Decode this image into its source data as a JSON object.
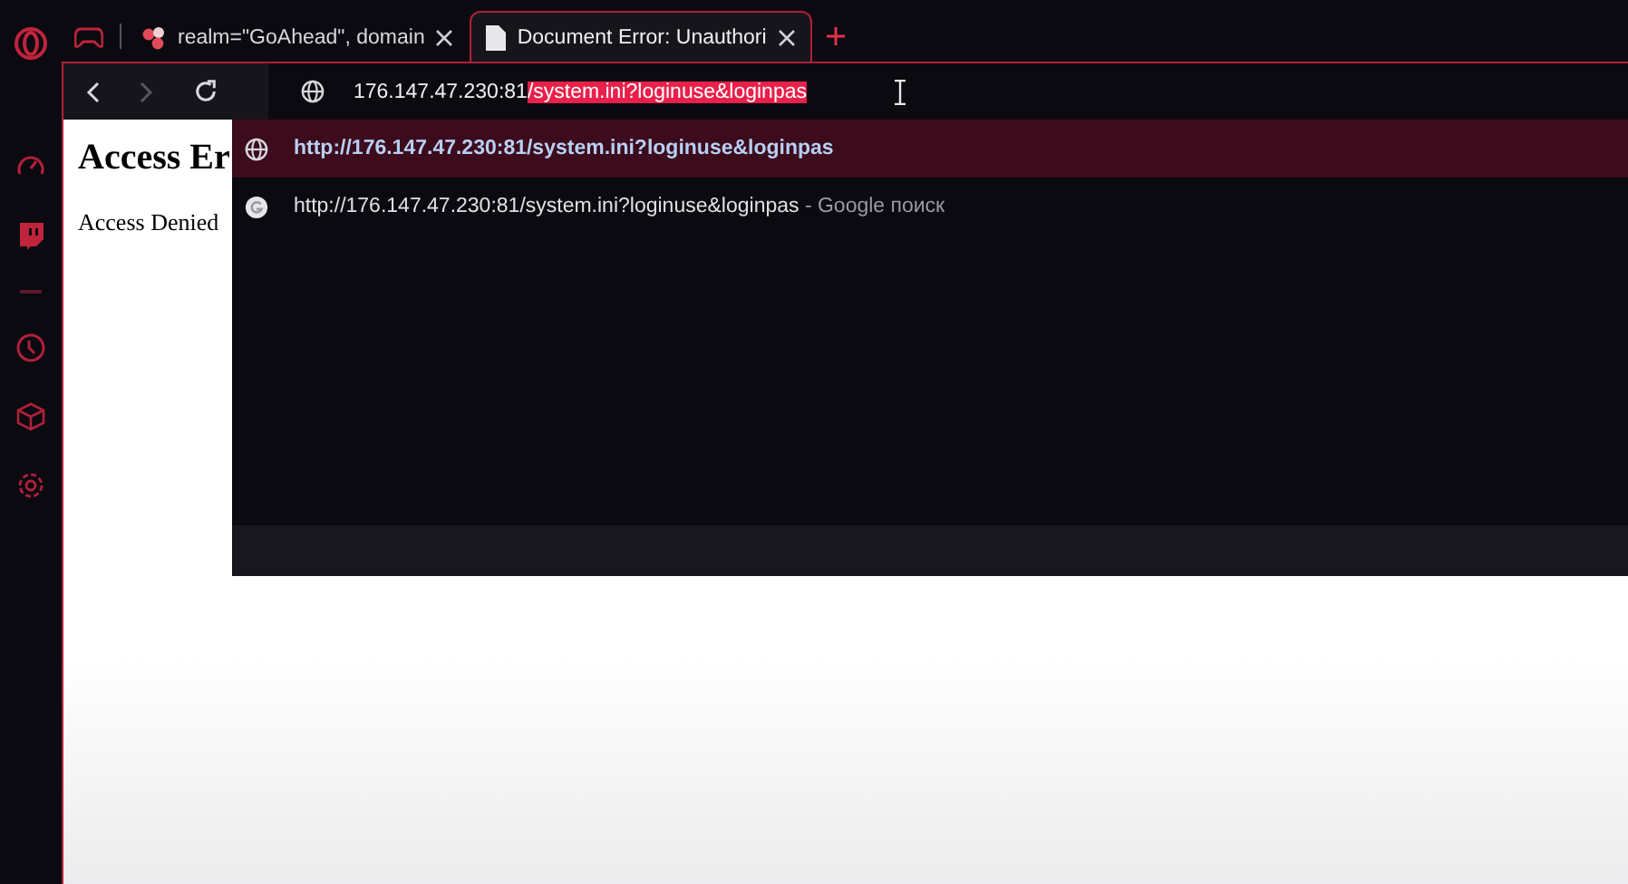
{
  "tabs": [
    {
      "kind": "pinned",
      "selected": false
    },
    {
      "kind": "site",
      "title": "realm=\"GoAhead\", domain",
      "selected": false
    },
    {
      "kind": "document",
      "title": "Document Error: Unauthori",
      "selected": true
    }
  ],
  "address": {
    "host": "176.147.47.230:81",
    "selected_text": "/system.ini?loginuse&loginpas"
  },
  "suggestions": [
    {
      "kind": "url",
      "text": "http://176.147.47.230:81/system.ini?loginuse&loginpas",
      "selected": true
    },
    {
      "kind": "search",
      "text": "http://176.147.47.230:81/system.ini?loginuse&loginpas",
      "suffix": "- Google поиск",
      "selected": false
    }
  ],
  "page": {
    "heading": "Access Er",
    "body": "Access Denied"
  }
}
